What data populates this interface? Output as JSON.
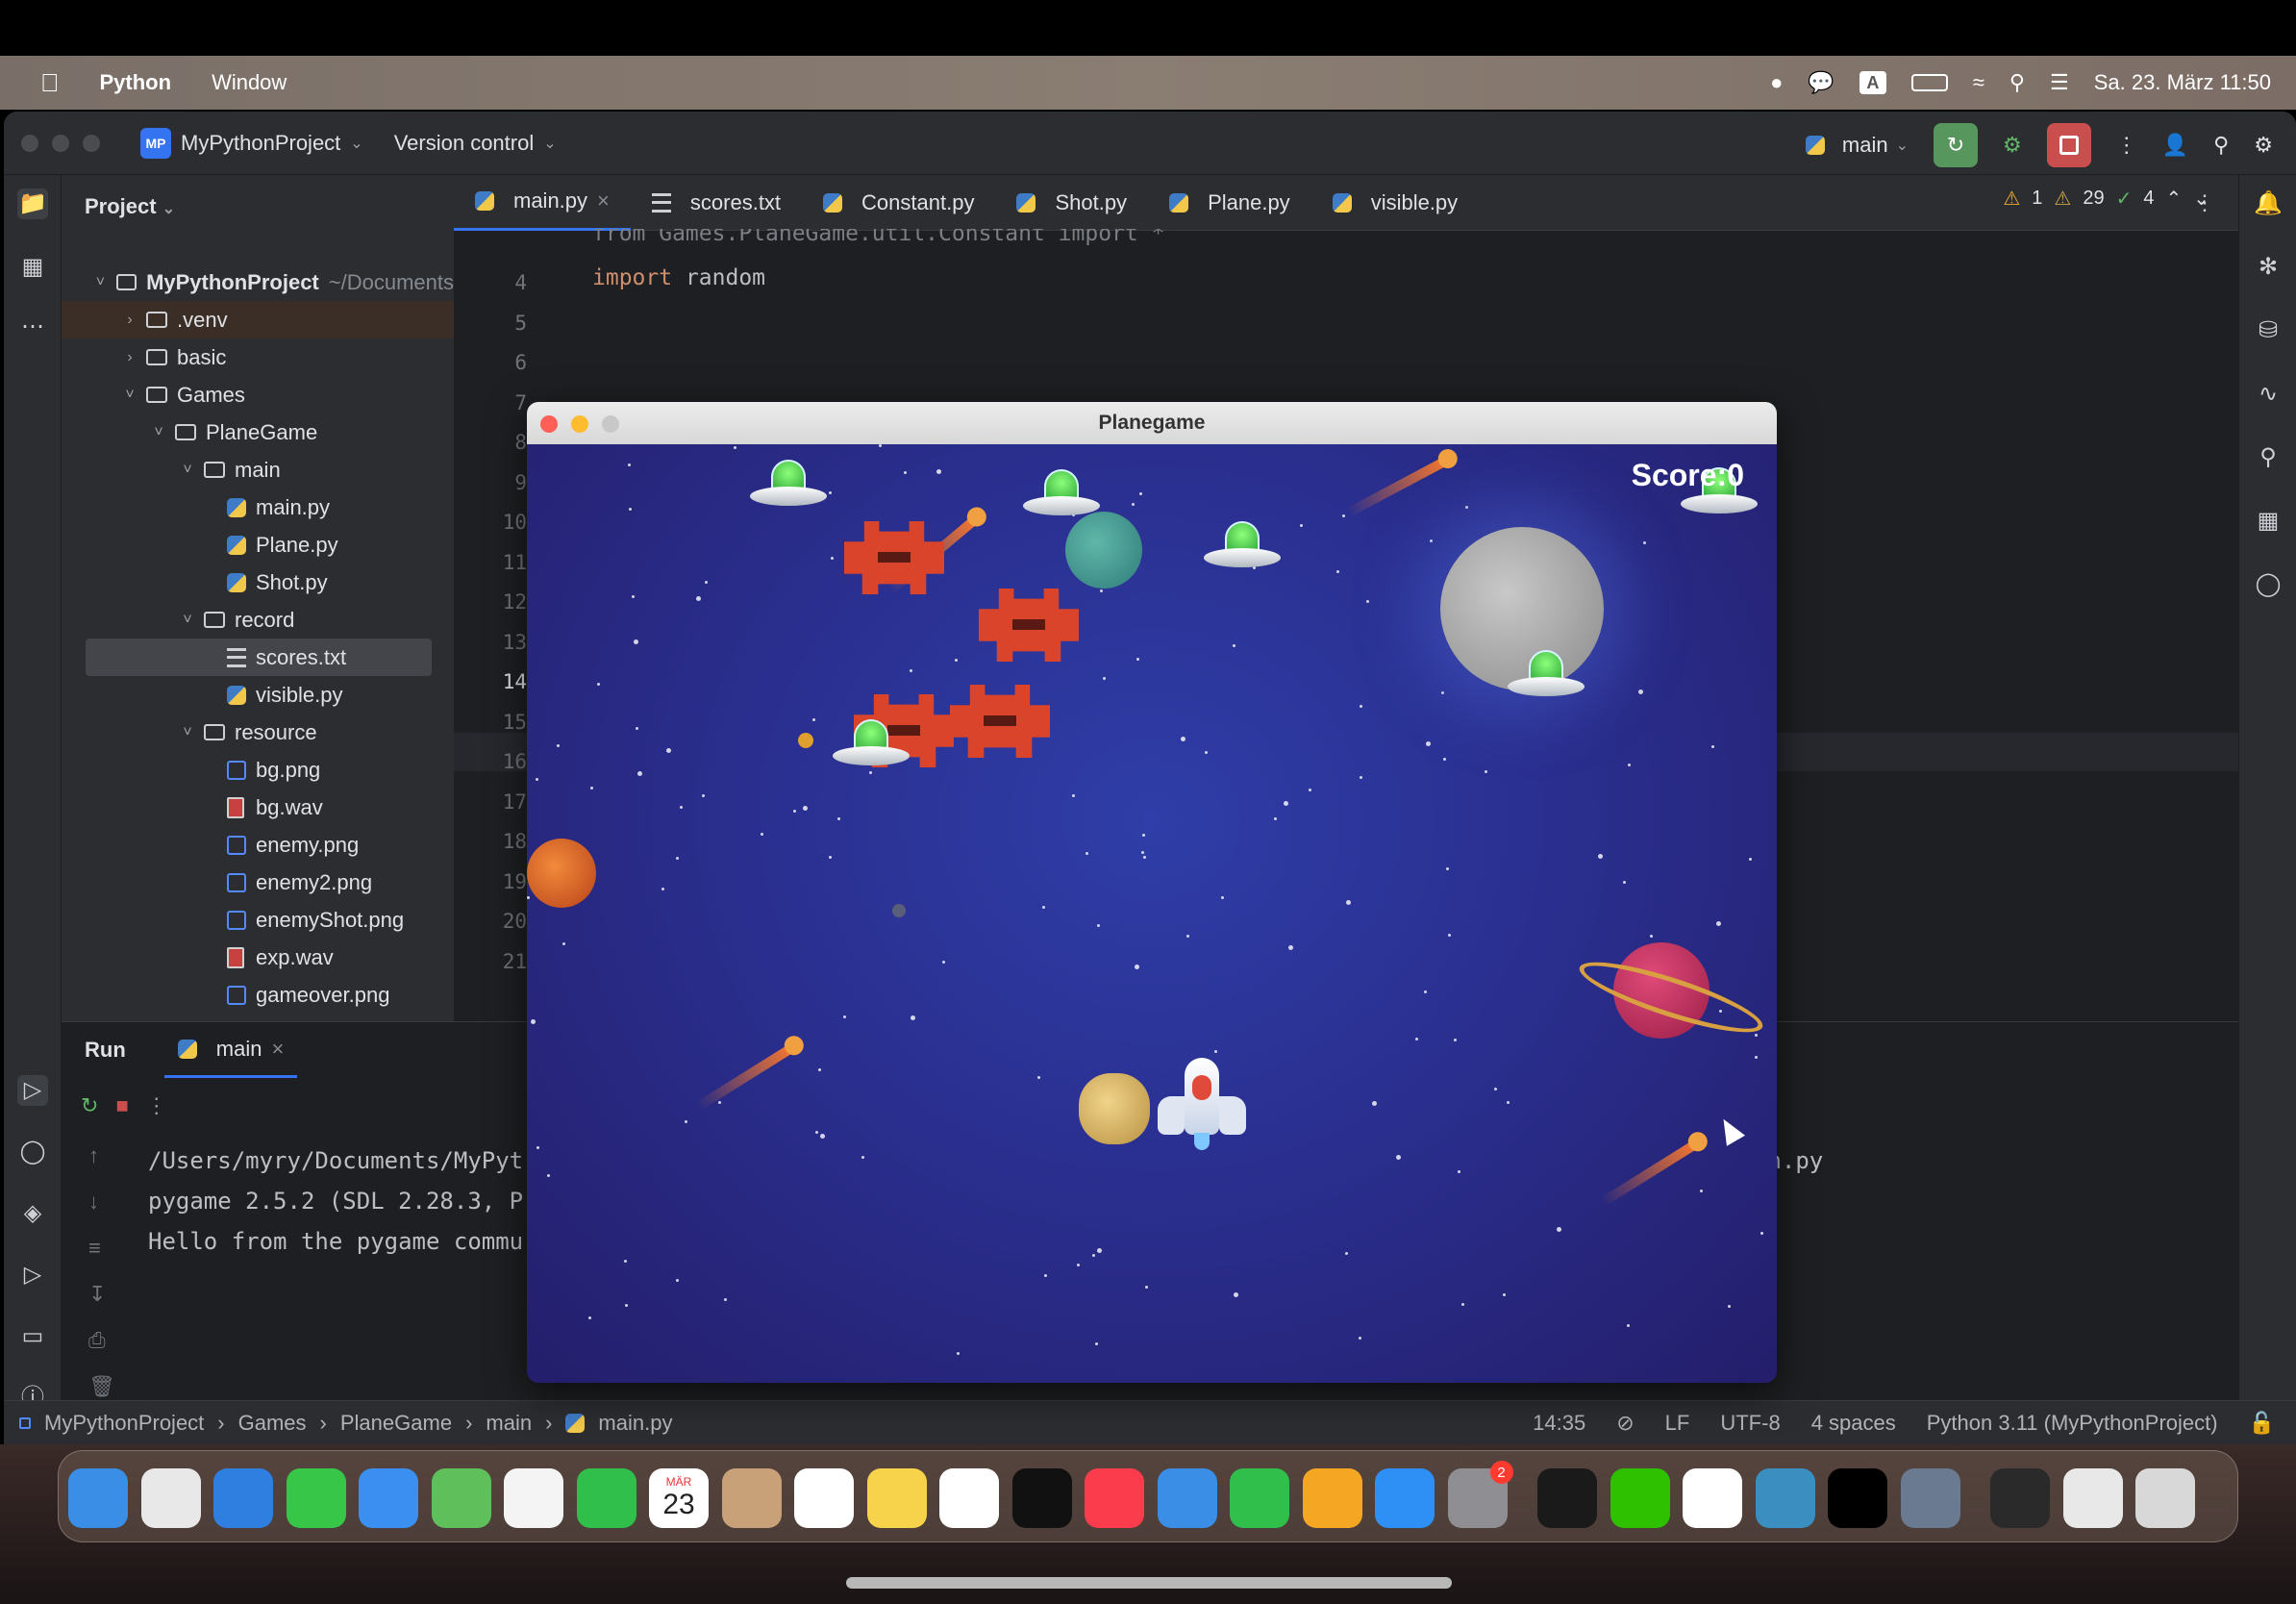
{
  "menubar": {
    "apple_icon": "apple-icon",
    "app_name": "Python",
    "menu_window": "Window",
    "datetime": "Sa. 23. März 11:50",
    "input_source": "A"
  },
  "ide": {
    "project_badge": "MP",
    "project_name": "MyPythonProject",
    "version_control": "Version control",
    "branch": "main"
  },
  "project_panel": {
    "header": "Project",
    "root": "MyPythonProject",
    "root_path": "~/Documents",
    "items": [
      ".venv",
      "basic",
      "Games",
      "PlaneGame",
      "main",
      "main.py",
      "Plane.py",
      "Shot.py",
      "record",
      "scores.txt",
      "visible.py",
      "resource",
      "bg.png",
      "bg.wav",
      "enemy.png",
      "enemy2.png",
      "enemyShot.png",
      "exp.wav",
      "gameover.png"
    ]
  },
  "tabs": [
    "main.py",
    "scores.txt",
    "Constant.py",
    "Shot.py",
    "Plane.py",
    "visible.py"
  ],
  "editor": {
    "line_numbers": [
      "4",
      "5",
      "6",
      "7",
      "8",
      "9",
      "10",
      "11",
      "12",
      "13",
      "14",
      "15",
      "16",
      "17",
      "18",
      "19",
      "20",
      "21"
    ],
    "partial_line": "from Games.PlaneGame.util.Constant import *",
    "code_kw": "import",
    "code_rest": " random",
    "warn_count": "1",
    "weak_warn_count": "29",
    "ok_count": "4"
  },
  "run": {
    "label": "Run",
    "config": "main",
    "lines": [
      "/Users/myry/Documents/MyPyt",
      "pygame 2.5.2 (SDL 2.28.3, P",
      "Hello from the pygame commu"
    ],
    "right_fragment": "in.py"
  },
  "statusbar": {
    "crumbs": [
      "MyPythonProject",
      "Games",
      "PlaneGame",
      "main",
      "main.py"
    ],
    "position": "14:35",
    "line_sep": "LF",
    "encoding": "UTF-8",
    "indent": "4 spaces",
    "interpreter": "Python 3.11 (MyPythonProject)"
  },
  "game": {
    "title": "Planegame",
    "score": "Score:0"
  },
  "dock": {
    "calendar_month": "MÄR",
    "calendar_day": "23",
    "settings_badge": "2"
  }
}
